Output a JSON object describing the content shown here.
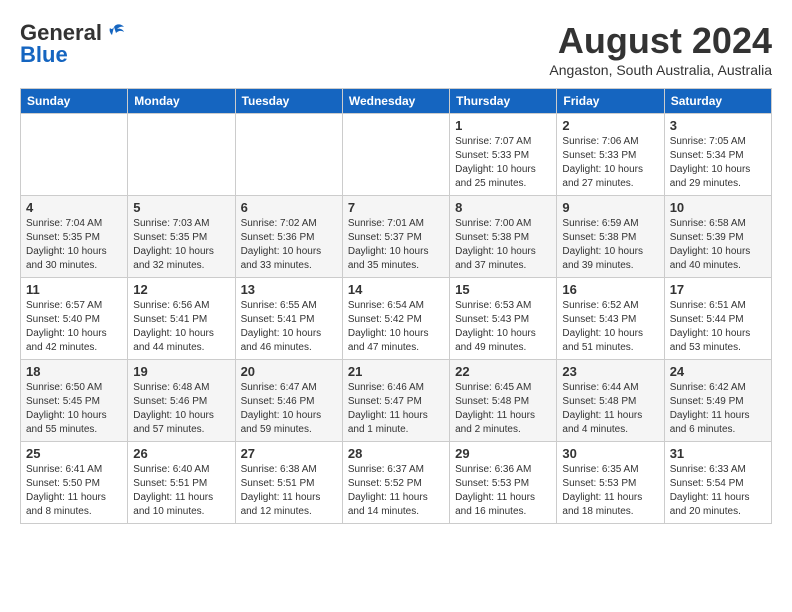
{
  "header": {
    "logo_general": "General",
    "logo_blue": "Blue",
    "month_title": "August 2024",
    "subtitle": "Angaston, South Australia, Australia"
  },
  "days_of_week": [
    "Sunday",
    "Monday",
    "Tuesday",
    "Wednesday",
    "Thursday",
    "Friday",
    "Saturday"
  ],
  "weeks": [
    [
      {
        "day": "",
        "info": ""
      },
      {
        "day": "",
        "info": ""
      },
      {
        "day": "",
        "info": ""
      },
      {
        "day": "",
        "info": ""
      },
      {
        "day": "1",
        "info": "Sunrise: 7:07 AM\nSunset: 5:33 PM\nDaylight: 10 hours\nand 25 minutes."
      },
      {
        "day": "2",
        "info": "Sunrise: 7:06 AM\nSunset: 5:33 PM\nDaylight: 10 hours\nand 27 minutes."
      },
      {
        "day": "3",
        "info": "Sunrise: 7:05 AM\nSunset: 5:34 PM\nDaylight: 10 hours\nand 29 minutes."
      }
    ],
    [
      {
        "day": "4",
        "info": "Sunrise: 7:04 AM\nSunset: 5:35 PM\nDaylight: 10 hours\nand 30 minutes."
      },
      {
        "day": "5",
        "info": "Sunrise: 7:03 AM\nSunset: 5:35 PM\nDaylight: 10 hours\nand 32 minutes."
      },
      {
        "day": "6",
        "info": "Sunrise: 7:02 AM\nSunset: 5:36 PM\nDaylight: 10 hours\nand 33 minutes."
      },
      {
        "day": "7",
        "info": "Sunrise: 7:01 AM\nSunset: 5:37 PM\nDaylight: 10 hours\nand 35 minutes."
      },
      {
        "day": "8",
        "info": "Sunrise: 7:00 AM\nSunset: 5:38 PM\nDaylight: 10 hours\nand 37 minutes."
      },
      {
        "day": "9",
        "info": "Sunrise: 6:59 AM\nSunset: 5:38 PM\nDaylight: 10 hours\nand 39 minutes."
      },
      {
        "day": "10",
        "info": "Sunrise: 6:58 AM\nSunset: 5:39 PM\nDaylight: 10 hours\nand 40 minutes."
      }
    ],
    [
      {
        "day": "11",
        "info": "Sunrise: 6:57 AM\nSunset: 5:40 PM\nDaylight: 10 hours\nand 42 minutes."
      },
      {
        "day": "12",
        "info": "Sunrise: 6:56 AM\nSunset: 5:41 PM\nDaylight: 10 hours\nand 44 minutes."
      },
      {
        "day": "13",
        "info": "Sunrise: 6:55 AM\nSunset: 5:41 PM\nDaylight: 10 hours\nand 46 minutes."
      },
      {
        "day": "14",
        "info": "Sunrise: 6:54 AM\nSunset: 5:42 PM\nDaylight: 10 hours\nand 47 minutes."
      },
      {
        "day": "15",
        "info": "Sunrise: 6:53 AM\nSunset: 5:43 PM\nDaylight: 10 hours\nand 49 minutes."
      },
      {
        "day": "16",
        "info": "Sunrise: 6:52 AM\nSunset: 5:43 PM\nDaylight: 10 hours\nand 51 minutes."
      },
      {
        "day": "17",
        "info": "Sunrise: 6:51 AM\nSunset: 5:44 PM\nDaylight: 10 hours\nand 53 minutes."
      }
    ],
    [
      {
        "day": "18",
        "info": "Sunrise: 6:50 AM\nSunset: 5:45 PM\nDaylight: 10 hours\nand 55 minutes."
      },
      {
        "day": "19",
        "info": "Sunrise: 6:48 AM\nSunset: 5:46 PM\nDaylight: 10 hours\nand 57 minutes."
      },
      {
        "day": "20",
        "info": "Sunrise: 6:47 AM\nSunset: 5:46 PM\nDaylight: 10 hours\nand 59 minutes."
      },
      {
        "day": "21",
        "info": "Sunrise: 6:46 AM\nSunset: 5:47 PM\nDaylight: 11 hours\nand 1 minute."
      },
      {
        "day": "22",
        "info": "Sunrise: 6:45 AM\nSunset: 5:48 PM\nDaylight: 11 hours\nand 2 minutes."
      },
      {
        "day": "23",
        "info": "Sunrise: 6:44 AM\nSunset: 5:48 PM\nDaylight: 11 hours\nand 4 minutes."
      },
      {
        "day": "24",
        "info": "Sunrise: 6:42 AM\nSunset: 5:49 PM\nDaylight: 11 hours\nand 6 minutes."
      }
    ],
    [
      {
        "day": "25",
        "info": "Sunrise: 6:41 AM\nSunset: 5:50 PM\nDaylight: 11 hours\nand 8 minutes."
      },
      {
        "day": "26",
        "info": "Sunrise: 6:40 AM\nSunset: 5:51 PM\nDaylight: 11 hours\nand 10 minutes."
      },
      {
        "day": "27",
        "info": "Sunrise: 6:38 AM\nSunset: 5:51 PM\nDaylight: 11 hours\nand 12 minutes."
      },
      {
        "day": "28",
        "info": "Sunrise: 6:37 AM\nSunset: 5:52 PM\nDaylight: 11 hours\nand 14 minutes."
      },
      {
        "day": "29",
        "info": "Sunrise: 6:36 AM\nSunset: 5:53 PM\nDaylight: 11 hours\nand 16 minutes."
      },
      {
        "day": "30",
        "info": "Sunrise: 6:35 AM\nSunset: 5:53 PM\nDaylight: 11 hours\nand 18 minutes."
      },
      {
        "day": "31",
        "info": "Sunrise: 6:33 AM\nSunset: 5:54 PM\nDaylight: 11 hours\nand 20 minutes."
      }
    ]
  ]
}
